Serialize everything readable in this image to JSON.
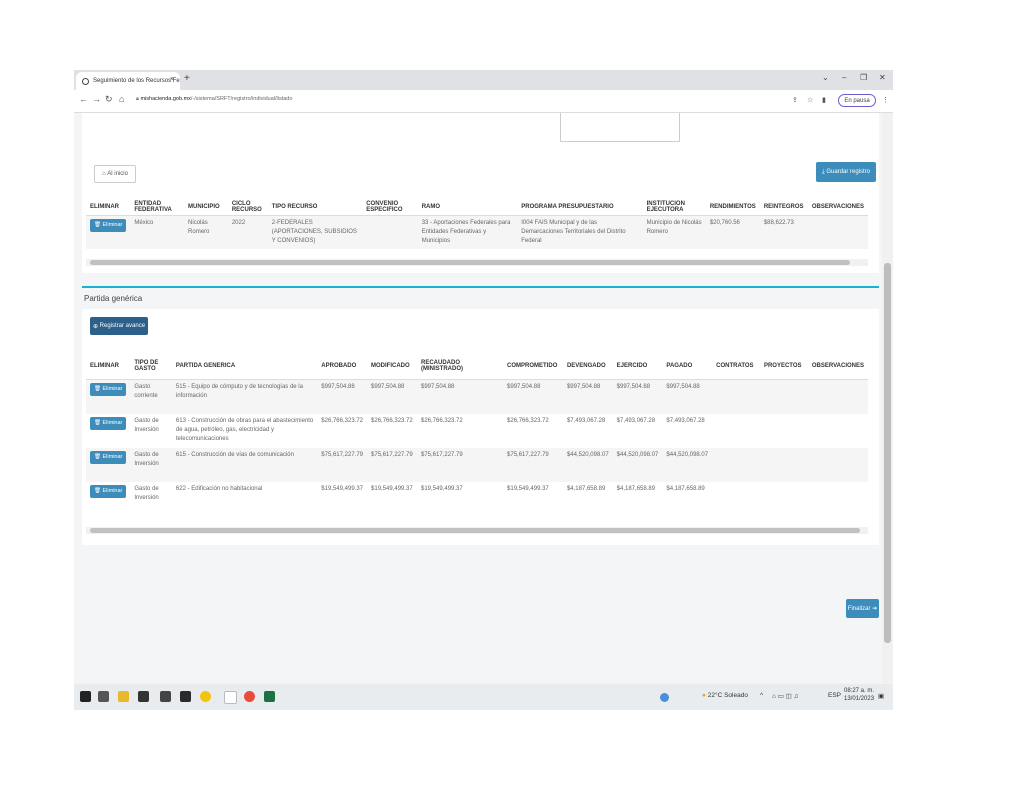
{
  "browser": {
    "tab_title": "Seguimiento de los Recursos Fe",
    "tab_close": "×",
    "new_tab": "+",
    "url_host": "mishacienda.gob.mx",
    "url_path": "/-/sistema/SRFT/registro/individual/listado",
    "pause_label": "En pausa",
    "win_min": "–",
    "win_max": "❐",
    "win_close": "✕"
  },
  "top_section": {
    "back_label": "Al inicio",
    "save_label": "Guardar registro",
    "columns": [
      "ELIMINAR",
      "ENTIDAD FEDERATIVA",
      "MUNICIPIO",
      "CICLO RECURSO",
      "TIPO RECURSO",
      "CONVENIO ESPECIFICO",
      "RAMO",
      "PROGRAMA PRESUPUESTARIO",
      "INSTITUCION EJECUTORA",
      "RENDIMIENTOS",
      "REINTEGROS",
      "OBSERVACIONES"
    ],
    "rows": [
      {
        "delete_label": "Eliminar",
        "entidad": "México",
        "municipio": "Nicolás Romero",
        "ciclo": "2022",
        "tipo_recurso": "2-FEDERALES (APORTACIONES, SUBSIDIOS Y CONVENIOS)",
        "convenio": "",
        "ramo": "33 - Aportaciones Federales para Entidades Federativas y Municipios",
        "programa": "I004 FAIS Municipal y de las Demarcaciones Territoriales del Distrito Federal",
        "institucion": "Municipio de Nicolás Romero",
        "rendimientos": "$20,760.56",
        "reintegros": "$88,622.73",
        "observaciones": ""
      }
    ]
  },
  "partida": {
    "title": "Partida genérica",
    "register_label": "Registrar avance",
    "columns": [
      "ELIMINAR",
      "TIPO DE GASTO",
      "PARTIDA GENERICA",
      "APROBADO",
      "MODIFICADO",
      "RECAUDADO (MINISTRADO)",
      "COMPROMETIDO",
      "DEVENGADO",
      "EJERCIDO",
      "PAGADO",
      "CONTRATOS",
      "PROYECTOS",
      "OBSERVACIONES"
    ],
    "rows": [
      {
        "delete_label": "Eliminar",
        "tipo": "Gasto corriente",
        "partida": "515 - Equipo de cómputo y de tecnologías de la información",
        "aprobado": "$997,504.88",
        "modificado": "$997,504.88",
        "recaudado": "$997,504.88",
        "comprometido": "$997,504.88",
        "devengado": "$997,504.88",
        "ejercido": "$997,504.88",
        "pagado": "$997,504.88"
      },
      {
        "delete_label": "Eliminar",
        "tipo": "Gasto de Inversión",
        "partida": "613 - Construcción de obras para el abastecimiento de agua, petróleo, gas, electricidad y telecomunicaciones",
        "aprobado": "$26,766,323.72",
        "modificado": "$26,766,323.72",
        "recaudado": "$26,766,323.72",
        "comprometido": "$26,766,323.72",
        "devengado": "$7,493,067.28",
        "ejercido": "$7,493,067.28",
        "pagado": "$7,493,067.28"
      },
      {
        "delete_label": "Eliminar",
        "tipo": "Gasto de Inversión",
        "partida": "615 - Construcción de vías de comunicación",
        "aprobado": "$75,617,227.79",
        "modificado": "$75,617,227.79",
        "recaudado": "$75,617,227.79",
        "comprometido": "$75,617,227.79",
        "devengado": "$44,520,098.07",
        "ejercido": "$44,520,098.07",
        "pagado": "$44,520,098.07"
      },
      {
        "delete_label": "Eliminar",
        "tipo": "Gasto de Inversión",
        "partida": "622 - Edificación no habitacional",
        "aprobado": "$19,549,499.37",
        "modificado": "$19,549,499.37",
        "recaudado": "$19,549,499.37",
        "comprometido": "$19,549,499.37",
        "devengado": "$4,187,658.89",
        "ejercido": "$4,187,658.89",
        "pagado": "$4,187,658.89"
      }
    ]
  },
  "finish_label": "Finalizar",
  "taskbar": {
    "weather": "22°C Soleado",
    "lang": "ESP",
    "time": "08:27 a. m.",
    "date": "13/01/2023"
  },
  "colors": {
    "primary": "#3c8dbc",
    "dark_button": "#2c5f8a",
    "accent_line": "#17b3d1"
  }
}
